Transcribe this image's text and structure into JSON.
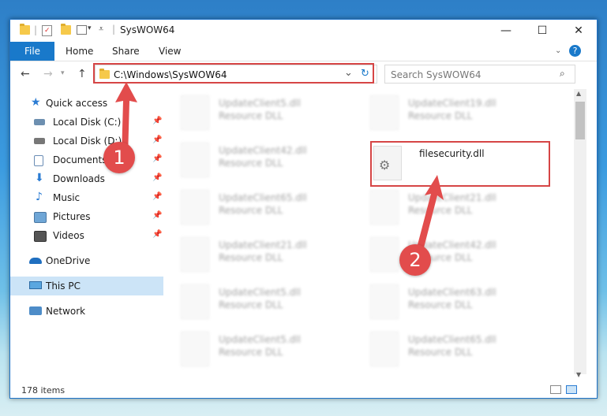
{
  "window": {
    "title": "SysWOW64",
    "controls": {
      "minimize": "—",
      "maximize": "☐",
      "close": "✕"
    }
  },
  "ribbon": {
    "file": "File",
    "home": "Home",
    "share": "Share",
    "view": "View",
    "help": "?"
  },
  "address": {
    "path": "C:\\Windows\\SysWOW64",
    "dropdown": "⌄",
    "refresh": "↻"
  },
  "search": {
    "placeholder": "Search SysWOW64"
  },
  "nav": {
    "back": "←",
    "forward": "→",
    "up": "↑",
    "items": [
      {
        "label": "Quick access",
        "icon": "star-icon"
      },
      {
        "label": "Local Disk (C:)",
        "icon": "drive-icon",
        "pinned": true
      },
      {
        "label": "Local Disk (D:)",
        "icon": "drive-icon",
        "pinned": true
      },
      {
        "label": "Documents",
        "icon": "documents-icon",
        "pinned": true
      },
      {
        "label": "Downloads",
        "icon": "downloads-icon",
        "pinned": true
      },
      {
        "label": "Music",
        "icon": "music-icon",
        "pinned": true
      },
      {
        "label": "Pictures",
        "icon": "pictures-icon",
        "pinned": true
      },
      {
        "label": "Videos",
        "icon": "videos-icon",
        "pinned": true
      },
      {
        "label": "OneDrive",
        "icon": "cloud-icon"
      },
      {
        "label": "This PC",
        "icon": "computer-icon",
        "selected": true
      },
      {
        "label": "Network",
        "icon": "network-icon"
      }
    ]
  },
  "files": {
    "col1": [
      {
        "name": "UpdateClient5.dll",
        "type": "Resource DLL"
      },
      {
        "name": "UpdateClient42.dll",
        "type": "Resource DLL"
      },
      {
        "name": "UpdateClient65.dll",
        "type": "Resource DLL"
      },
      {
        "name": "UpdateClient21.dll",
        "type": "Resource DLL"
      },
      {
        "name": "UpdateClient5.dll",
        "type": "Resource DLL"
      },
      {
        "name": "UpdateClient5.dll",
        "type": "Resource DLL"
      }
    ],
    "col2": [
      {
        "name": "UpdateClient19.dll",
        "type": "Resource DLL"
      },
      {
        "name": "filesecurity.dll",
        "type": "",
        "highlighted": true
      },
      {
        "name": "UpdateClient21.dll",
        "type": "Resource DLL"
      },
      {
        "name": "UpdateClient42.dll",
        "type": "Resource DLL"
      },
      {
        "name": "UpdateClient63.dll",
        "type": "Resource DLL"
      },
      {
        "name": "UpdateClient65.dll",
        "type": "Resource DLL"
      }
    ]
  },
  "callouts": {
    "one": "1",
    "two": "2"
  },
  "status": {
    "items": "178 items"
  },
  "colors": {
    "accent": "#1979ca",
    "highlight": "#d64545",
    "selected": "#cce4f7"
  }
}
